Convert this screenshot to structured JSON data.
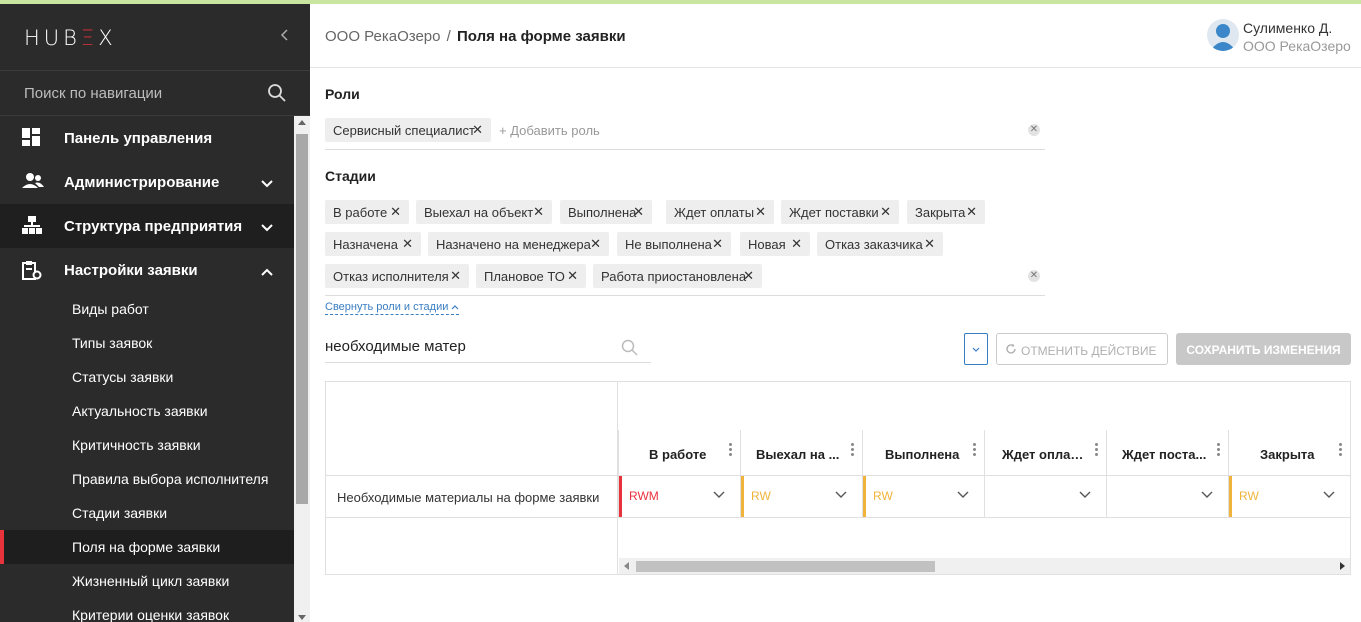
{
  "app": {
    "logo_left": "HUB",
    "logo_accent": "Ξ",
    "logo_right": "X"
  },
  "sidebar": {
    "search_placeholder": "Поиск по навигации",
    "items": [
      {
        "label": "Панель управления",
        "icon": "dashboard-icon"
      },
      {
        "label": "Администрирование",
        "icon": "users-icon"
      },
      {
        "label": "Структура предприятия",
        "icon": "org-structure-icon"
      },
      {
        "label": "Настройки заявки",
        "icon": "request-settings-icon"
      }
    ],
    "sub_items": [
      "Виды работ",
      "Типы заявок",
      "Статусы заявки",
      "Актуальность заявки",
      "Критичность заявки",
      "Правила выбора исполнителя",
      "Стадии заявки",
      "Поля на форме заявки",
      "Жизненный цикл заявки",
      "Критерии оценки заявок"
    ]
  },
  "header": {
    "org": "ООО РекаОзеро",
    "separator": "/",
    "page": "Поля на форме заявки",
    "user_name": "Сулименко Д.",
    "user_org": "ООО РекаОзеро"
  },
  "roles": {
    "title": "Роли",
    "tags": [
      "Сервисный специалист"
    ],
    "add_placeholder": "+ Добавить роль"
  },
  "stages": {
    "title": "Стадии",
    "tags": [
      "В работе",
      "Выехал на объект",
      "Выполнена",
      "Ждет оплаты",
      "Ждет поставки",
      "Закрыта",
      "Назначена",
      "Назначено на менеджера",
      "Не выполнена",
      "Новая",
      "Отказ заказчика",
      "Отказ исполнителя",
      "Плановое ТО",
      "Работа приостановлена"
    ]
  },
  "collapse_link": "Свернуть роли и стадии",
  "filter": {
    "value": "необходимые матер"
  },
  "toolbar": {
    "undo_label": "ОТМЕНИТЬ ДЕЙСТВИЕ",
    "save_label": "СОХРАНИТЬ ИЗМЕНЕНИЯ"
  },
  "grid": {
    "columns": [
      "В работе",
      "Выехал на ...",
      "Выполнена",
      "Ждет оплаты",
      "Ждет поста...",
      "Закрыта"
    ],
    "rows": [
      {
        "label": "Необходимые материалы на форме заявки",
        "cells": [
          "RWM",
          "RW",
          "RW",
          "",
          "",
          "RW"
        ]
      }
    ]
  },
  "colors": {
    "accent_red": "#e8323c",
    "rw_orange": "#f0b43c",
    "link_blue": "#3a7ec2"
  }
}
